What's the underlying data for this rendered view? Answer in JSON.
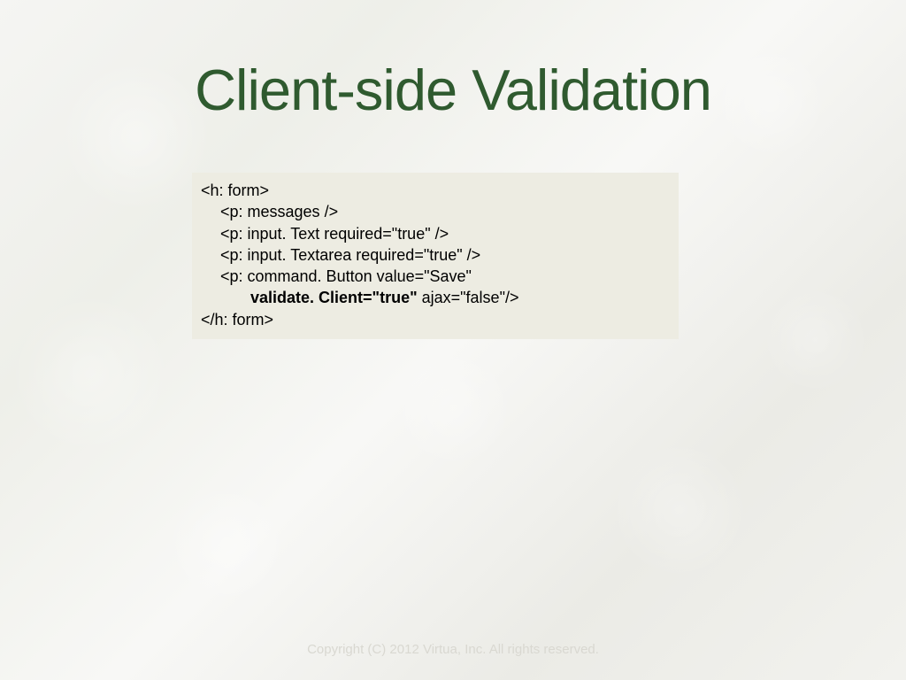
{
  "slide": {
    "title": "Client-side Validation",
    "footer": "Copyright (C) 2012 Virtua, Inc. All rights reserved."
  },
  "code": {
    "line1": "<h: form>",
    "line2": "<p: messages />",
    "line3": "<p: input. Text required=\"true\" />",
    "line4": "<p: input. Textarea required=\"true\" />",
    "line5": "<p: command. Button value=\"Save\"",
    "line6_normal": "validate. Client=\"true\"",
    "line6_rest": " ajax=\"false\"/>",
    "line7": "</h: form>"
  }
}
